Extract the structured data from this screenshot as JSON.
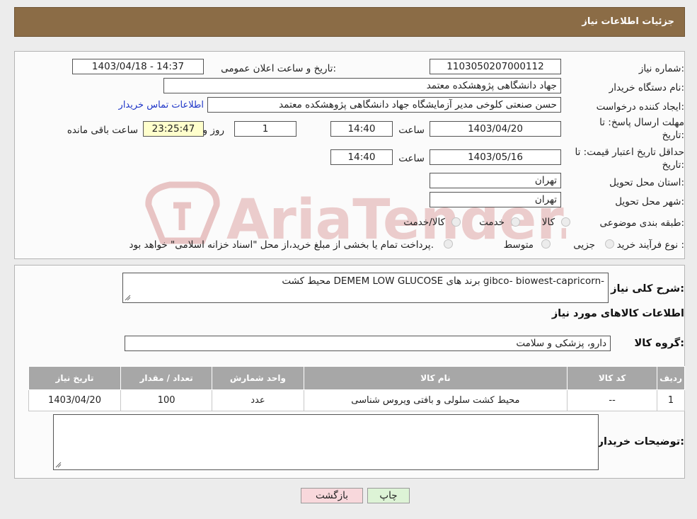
{
  "header": {
    "title": "جزئیات اطلاعات نیاز"
  },
  "info": {
    "need_number_label": "شماره نیاز:",
    "need_number": "1103050207000112",
    "announce_label": "تاریخ و ساعت اعلان عمومی:",
    "announce_value": "1403/04/18 - 14:37",
    "buyer_org_label": "نام دستگاه خریدار:",
    "buyer_org": "جهاد دانشگاهی پژوهشکده معتمد",
    "creator_label": "ایجاد کننده درخواست:",
    "creator": "حسن صنعتی کلوخی مدیر آزمایشگاه جهاد دانشگاهی پژوهشکده معتمد",
    "contact_link": "اطلاعات تماس خریدار",
    "reply_deadline_label_1": "مهلت ارسال پاسخ: تا",
    "reply_deadline_label_2": "تاریخ:",
    "reply_date": "1403/04/20",
    "time_label": "ساعت",
    "reply_time": "14:40",
    "days": "1",
    "days_label": "روز و",
    "remaining": "23:25:47",
    "remaining_label": "ساعت باقی مانده",
    "price_valid_label_1": "حداقل تاریخ اعتبار قیمت: تا",
    "price_valid_label_2": "تاریخ:",
    "price_valid_date": "1403/05/16",
    "price_valid_time": "14:40",
    "province_label": "استان محل تحویل:",
    "province": "تهران",
    "city_label": "شهر محل تحویل:",
    "city": "تهران",
    "category_label": "طبقه بندی موضوعی:",
    "category_options": [
      "کالا",
      "خدمت",
      "کالا/خدمت"
    ],
    "process_label": "نوع فرآیند خرید :",
    "process_options": [
      "جزیی",
      "متوسط"
    ],
    "process_note": "پرداخت تمام یا بخشی از مبلغ خرید،از محل \"اسناد خزانه اسلامی\" خواهد بود."
  },
  "details": {
    "description_label": "شرح کلی نیاز:",
    "description": "محیط کشت  DEMEM LOW GLUCOSE برند های gibco- biowest-capricorn-",
    "goods_info_title": "اطلاعات کالاهای مورد نیاز",
    "goods_group_label": "گروه کالا:",
    "goods_group": "دارو، پزشکی و سلامت",
    "table": {
      "headers": [
        "ردیف",
        "کد کالا",
        "نام کالا",
        "واحد شمارش",
        "تعداد / مقدار",
        "تاریخ نیاز"
      ],
      "rows": [
        [
          "1",
          "--",
          "محیط کشت سلولی و بافتی ویروس شناسی",
          "عدد",
          "100",
          "1403/04/20"
        ]
      ]
    },
    "buyer_notes_label": "توضیحات خریدار:",
    "buyer_notes": ""
  },
  "buttons": {
    "print": "چاپ",
    "back": "بازگشت"
  },
  "watermark": {
    "text": "AriaTender.neT"
  },
  "colors": {
    "header": "#8b6c46",
    "link": "#1f36c8",
    "back_button": "#f8d8dc",
    "print_button": "#ddf3d6"
  }
}
